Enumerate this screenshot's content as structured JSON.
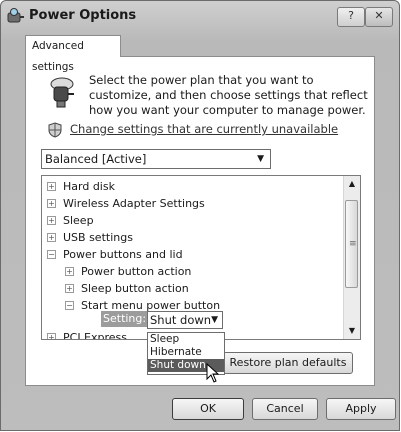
{
  "window": {
    "title": "Power Options",
    "help_glyph": "?",
    "close_glyph": "✕"
  },
  "tab": {
    "label": "Advanced settings"
  },
  "intro": {
    "text": "Select the power plan that you want to customize, and then choose settings that reflect how you want your computer to manage power."
  },
  "change_link": "Change settings that are currently unavailable",
  "plan_select": {
    "value": "Balanced [Active]"
  },
  "tree": {
    "items": [
      {
        "label": "Hard disk",
        "state": "+"
      },
      {
        "label": "Wireless Adapter Settings",
        "state": "+"
      },
      {
        "label": "Sleep",
        "state": "+"
      },
      {
        "label": "USB settings",
        "state": "+"
      },
      {
        "label": "Power buttons and lid",
        "state": "−"
      },
      {
        "label": "Power button action",
        "state": "+"
      },
      {
        "label": "Sleep button action",
        "state": "+"
      },
      {
        "label": "Start menu power button",
        "state": "−"
      },
      {
        "label": "PCI Express",
        "state": "+"
      }
    ],
    "setting_label": "Setting:",
    "setting_value": "Shut down",
    "scrollbar_grip": "≡"
  },
  "dropdown": {
    "options": [
      "Sleep",
      "Hibernate",
      "Shut down"
    ],
    "selected": "Shut down"
  },
  "buttons": {
    "restore": "Restore plan defaults",
    "ok": "OK",
    "cancel": "Cancel",
    "apply": "Apply"
  }
}
